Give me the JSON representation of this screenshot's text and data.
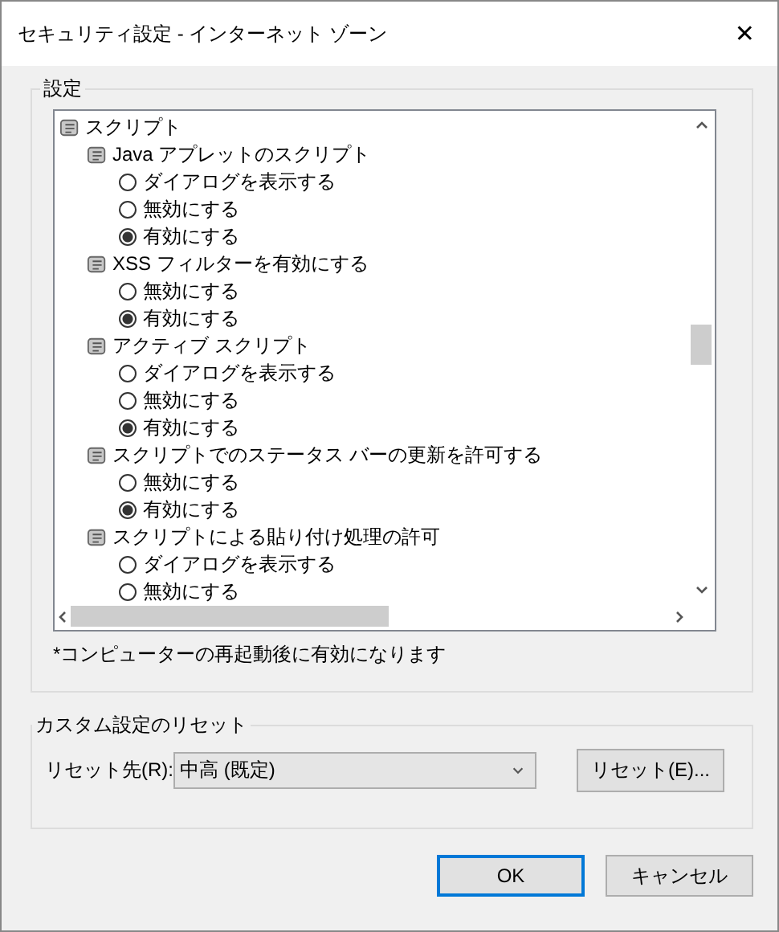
{
  "window": {
    "title": "セキュリティ設定 - インターネット ゾーン",
    "close": "✕"
  },
  "settings_group": {
    "label": "設定",
    "tree": {
      "label": "スクリプト",
      "children": [
        {
          "label": "Java アプレットのスクリプト",
          "options": [
            {
              "label": "ダイアログを表示する",
              "selected": false
            },
            {
              "label": "無効にする",
              "selected": false
            },
            {
              "label": "有効にする",
              "selected": true
            }
          ]
        },
        {
          "label": "XSS フィルターを有効にする",
          "options": [
            {
              "label": "無効にする",
              "selected": false
            },
            {
              "label": "有効にする",
              "selected": true
            }
          ]
        },
        {
          "label": "アクティブ スクリプト",
          "options": [
            {
              "label": "ダイアログを表示する",
              "selected": false
            },
            {
              "label": "無効にする",
              "selected": false
            },
            {
              "label": "有効にする",
              "selected": true
            }
          ]
        },
        {
          "label": "スクリプトでのステータス バーの更新を許可する",
          "options": [
            {
              "label": "無効にする",
              "selected": false
            },
            {
              "label": "有効にする",
              "selected": true
            }
          ]
        },
        {
          "label": "スクリプトによる貼り付け処理の許可",
          "options": [
            {
              "label": "ダイアログを表示する",
              "selected": false
            },
            {
              "label": "無効にする",
              "selected": false
            }
          ]
        }
      ]
    },
    "note": "*コンピューターの再起動後に有効になります"
  },
  "reset_group": {
    "label": "カスタム設定のリセット",
    "reset_to_label": "リセット先(R):",
    "reset_to_value": "中高 (既定)",
    "reset_button": "リセット(E)..."
  },
  "buttons": [
    {
      "label": "OK",
      "default": true
    },
    {
      "label": "キャンセル",
      "default": false
    }
  ]
}
